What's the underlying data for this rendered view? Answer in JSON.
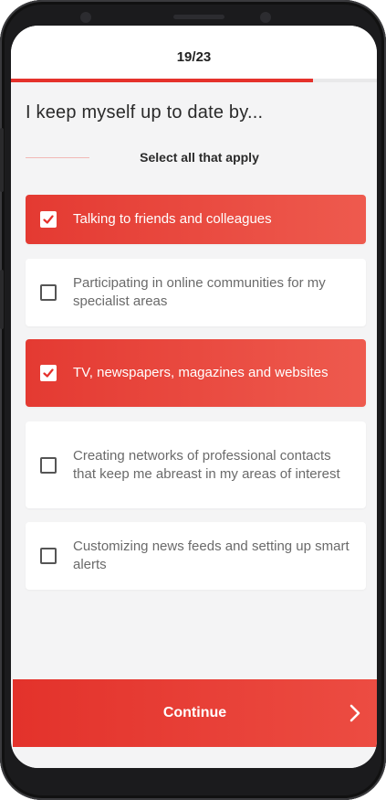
{
  "progress": {
    "counter": "19/23",
    "fraction": 0.826
  },
  "question": "I keep myself up to date by...",
  "instruction": "Select all that apply",
  "options": [
    {
      "label": "Talking to friends and colleagues",
      "selected": true
    },
    {
      "label": "Participating in online communities for my specialist areas",
      "selected": false
    },
    {
      "label": "TV, newspapers, magazines and websites",
      "selected": true
    },
    {
      "label": "Creating networks of professional contacts that keep me abreast in my areas of interest",
      "selected": false
    },
    {
      "label": "Customizing news feeds and setting up smart alerts",
      "selected": false
    }
  ],
  "continue_label": "Continue",
  "icons": {
    "checkbox": "checkmark-icon",
    "next": "chevron-right-icon"
  },
  "colors": {
    "accent": "#e5312b",
    "background": "#f4f4f5"
  }
}
